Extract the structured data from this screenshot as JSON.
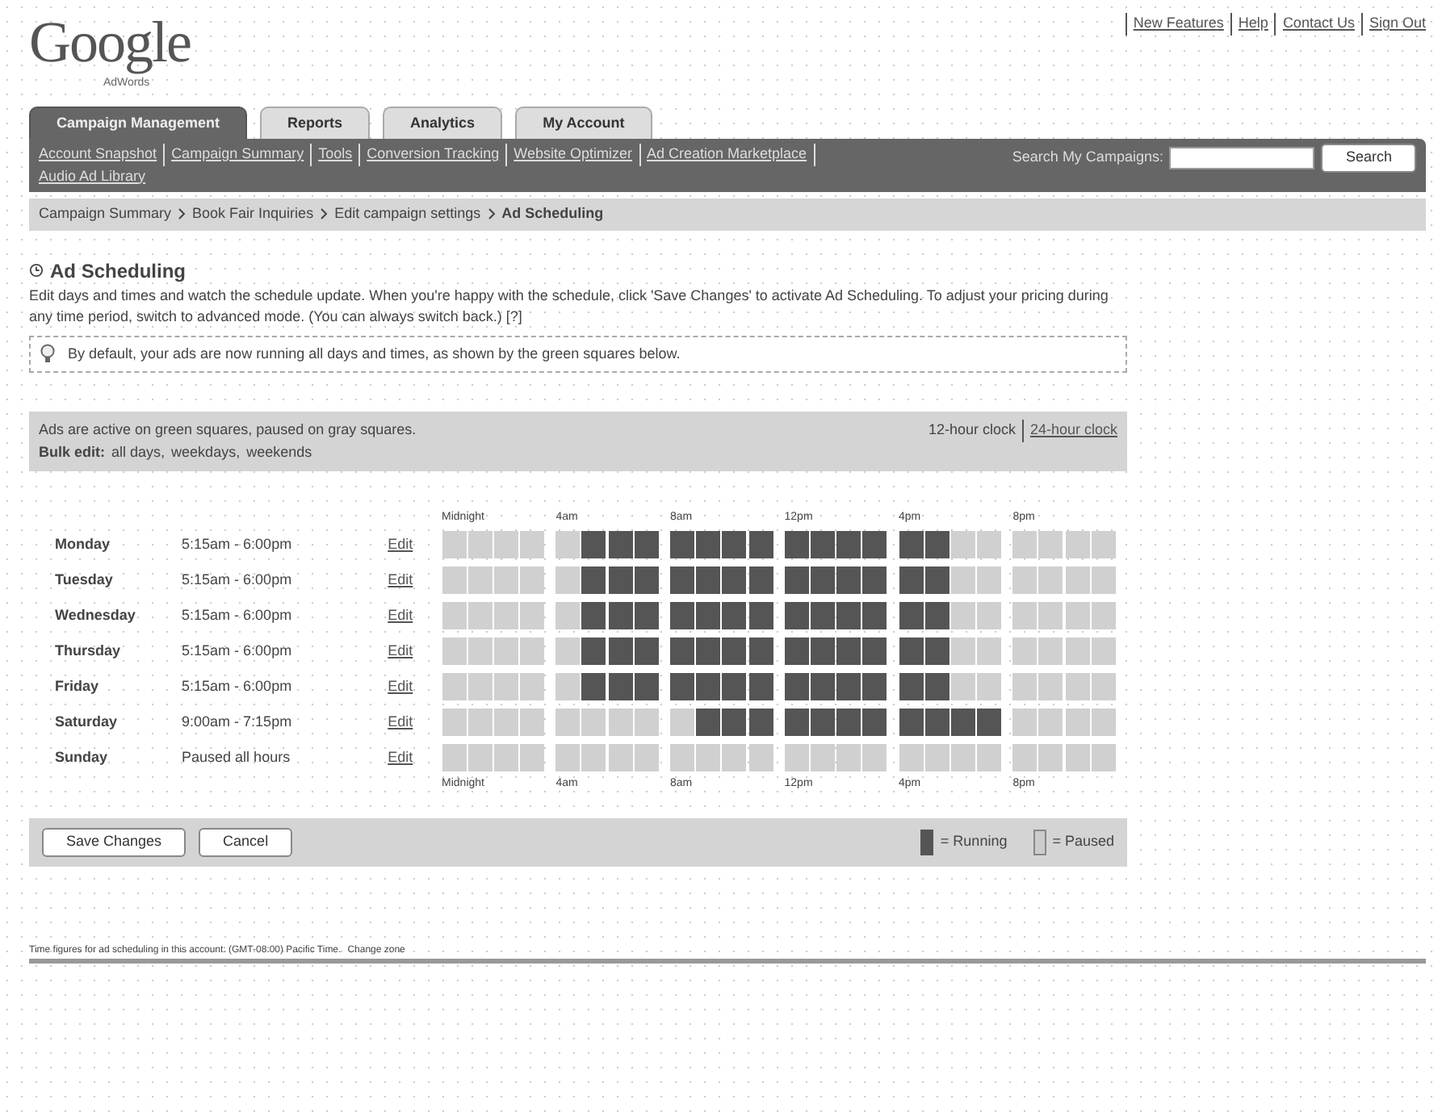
{
  "logo": {
    "wordmark": "Google",
    "product": "AdWords"
  },
  "top_links": [
    "New Features",
    "Help",
    "Contact Us",
    "Sign Out"
  ],
  "tabs": [
    {
      "label": "Campaign Management",
      "selected": true
    },
    {
      "label": "Reports",
      "selected": false
    },
    {
      "label": "Analytics",
      "selected": false
    },
    {
      "label": "My Account",
      "selected": false
    }
  ],
  "subnav_links": [
    "Account Snapshot",
    "Campaign Summary",
    "Tools",
    "Conversion Tracking",
    "Website Optimizer",
    "Ad Creation Marketplace",
    "Audio Ad Library"
  ],
  "search": {
    "label": "Search My Campaigns:",
    "button": "Search"
  },
  "breadcrumb": [
    {
      "label": "Campaign Summary",
      "link": true
    },
    {
      "label": "Book Fair Inquiries",
      "link": true
    },
    {
      "label": "Edit campaign settings",
      "link": true
    },
    {
      "label": "Ad Scheduling",
      "link": false
    }
  ],
  "title": "Ad Scheduling",
  "intro": {
    "text": "Edit days and times and watch the schedule update. When you're happy with the schedule, click 'Save Changes' to activate Ad Scheduling. To adjust your pricing during any time period,",
    "link": "switch to advanced mode",
    "after": ". (You can always switch back.)",
    "help": "[?]"
  },
  "tip": "By default, your ads are now running all days and times, as shown by the green squares below.",
  "legend_box": {
    "text": "Ads are active on green squares, paused on gray squares.",
    "clock_links": [
      "12-hour clock",
      "24-hour clock"
    ],
    "bulk_label": "Bulk edit:",
    "bulk_links": [
      "all days,",
      "weekdays,",
      "weekends"
    ]
  },
  "top_hour_labels": [
    "Midnight",
    "4am",
    "8am",
    "12pm",
    "4pm",
    "8pm"
  ],
  "bottom_hour_labels": [
    "Midnight",
    "4am",
    "8am",
    "12pm",
    "4pm",
    "8pm"
  ],
  "days": [
    {
      "name": "Monday",
      "times": "5:15am - 6:00pm",
      "edit": "Edit",
      "hours": [
        false,
        false,
        false,
        false,
        false,
        true,
        true,
        true,
        true,
        true,
        true,
        true,
        true,
        true,
        true,
        true,
        true,
        true,
        false,
        false,
        false,
        false,
        false,
        false
      ]
    },
    {
      "name": "Tuesday",
      "times": "5:15am - 6:00pm",
      "edit": "Edit",
      "hours": [
        false,
        false,
        false,
        false,
        false,
        true,
        true,
        true,
        true,
        true,
        true,
        true,
        true,
        true,
        true,
        true,
        true,
        true,
        false,
        false,
        false,
        false,
        false,
        false
      ]
    },
    {
      "name": "Wednesday",
      "times": "5:15am - 6:00pm",
      "edit": "Edit",
      "hours": [
        false,
        false,
        false,
        false,
        false,
        true,
        true,
        true,
        true,
        true,
        true,
        true,
        true,
        true,
        true,
        true,
        true,
        true,
        false,
        false,
        false,
        false,
        false,
        false
      ]
    },
    {
      "name": "Thursday",
      "times": "5:15am - 6:00pm",
      "edit": "Edit",
      "hours": [
        false,
        false,
        false,
        false,
        false,
        true,
        true,
        true,
        true,
        true,
        true,
        true,
        true,
        true,
        true,
        true,
        true,
        true,
        false,
        false,
        false,
        false,
        false,
        false
      ]
    },
    {
      "name": "Friday",
      "times": "5:15am - 6:00pm",
      "edit": "Edit",
      "hours": [
        false,
        false,
        false,
        false,
        false,
        true,
        true,
        true,
        true,
        true,
        true,
        true,
        true,
        true,
        true,
        true,
        true,
        true,
        false,
        false,
        false,
        false,
        false,
        false
      ]
    },
    {
      "name": "Saturday",
      "times": "9:00am - 7:15pm",
      "edit": "Edit",
      "hours": [
        false,
        false,
        false,
        false,
        false,
        false,
        false,
        false,
        false,
        true,
        true,
        true,
        true,
        true,
        true,
        true,
        true,
        true,
        true,
        true,
        false,
        false,
        false,
        false
      ]
    },
    {
      "name": "Sunday",
      "times": "Paused all hours",
      "edit": "Edit",
      "hours": [
        false,
        false,
        false,
        false,
        false,
        false,
        false,
        false,
        false,
        false,
        false,
        false,
        false,
        false,
        false,
        false,
        false,
        false,
        false,
        false,
        false,
        false,
        false,
        false
      ]
    }
  ],
  "buttons": [
    "Save Changes",
    "Cancel"
  ],
  "legend": [
    "= Running",
    "= Paused"
  ],
  "footer": {
    "text": "Time figures for ad scheduling in this account: (GMT-08:00) Pacific Time.",
    "link": "Change zone"
  }
}
